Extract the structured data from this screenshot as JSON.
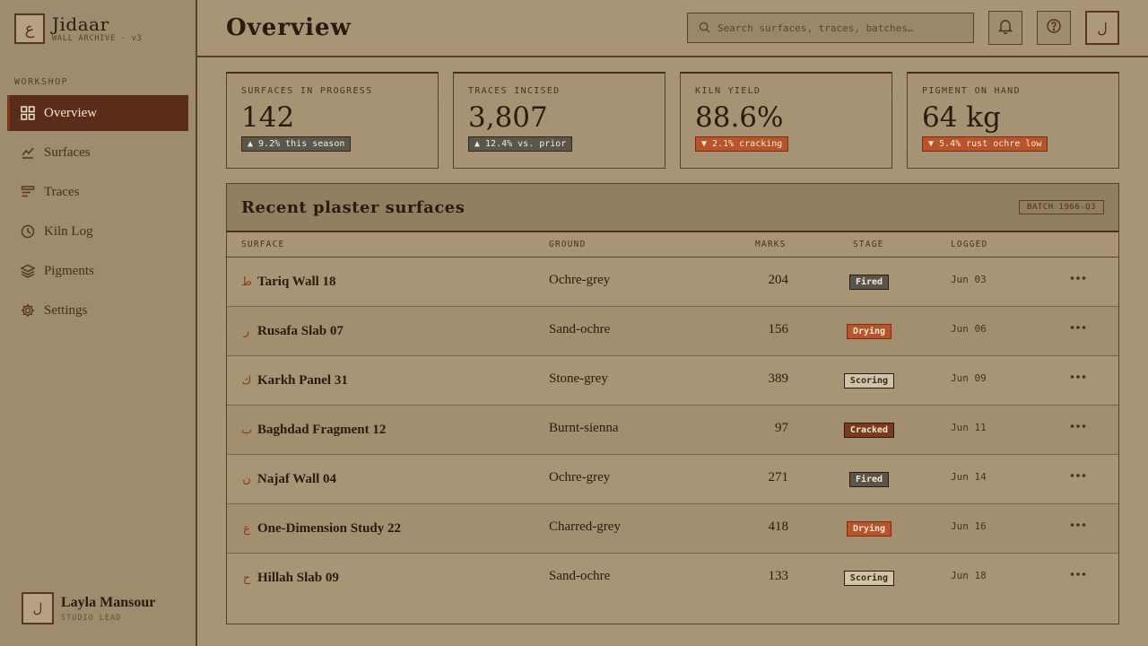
{
  "brand": {
    "name": "Jidaar",
    "subtitle": "WALL ARCHIVE · v3",
    "logo_glyph": "ع"
  },
  "sidebar": {
    "section_label": "WORKSHOP",
    "items": [
      {
        "label": "Overview",
        "icon": "grid-icon",
        "active": true
      },
      {
        "label": "Surfaces",
        "icon": "chart-line-icon",
        "active": false
      },
      {
        "label": "Traces",
        "icon": "layers-list-icon",
        "active": false
      },
      {
        "label": "Kiln Log",
        "icon": "clock-icon",
        "active": false
      },
      {
        "label": "Pigments",
        "icon": "stack-icon",
        "active": false
      },
      {
        "label": "Settings",
        "icon": "gear-icon",
        "active": false
      }
    ],
    "user": {
      "name": "Layla Mansour",
      "role": "STUDIO LEAD",
      "avatar_glyph": "ل"
    }
  },
  "header": {
    "title": "Overview",
    "search_placeholder": "Search surfaces, traces, batches…",
    "avatar_glyph": "ل"
  },
  "stats": [
    {
      "label": "SURFACES IN PROGRESS",
      "value": "142",
      "delta": "▲ 9.2% this season",
      "trend": "up"
    },
    {
      "label": "TRACES INCISED",
      "value": "3,807",
      "delta": "▲ 12.4% vs. prior",
      "trend": "up"
    },
    {
      "label": "KILN YIELD",
      "value": "88.6%",
      "delta": "▼ 2.1% cracking",
      "trend": "down"
    },
    {
      "label": "PIGMENT ON HAND",
      "value": "64 kg",
      "delta": "▼ 5.4% rust ochre low",
      "trend": "down"
    }
  ],
  "table": {
    "title": "Recent plaster surfaces",
    "batch": "BATCH 1966-Q3",
    "columns": [
      "SURFACE",
      "GROUND",
      "MARKS",
      "STAGE",
      "LOGGED"
    ],
    "rows": [
      {
        "glyph": "ط",
        "surface": "Tariq Wall 18",
        "ground": "Ochre-grey",
        "marks": "204",
        "stage": "Fired",
        "stage_kind": "fired",
        "logged": "Jun 03"
      },
      {
        "glyph": "ر",
        "surface": "Rusafa Slab 07",
        "ground": "Sand-ochre",
        "marks": "156",
        "stage": "Drying",
        "stage_kind": "drying",
        "logged": "Jun 06"
      },
      {
        "glyph": "ك",
        "surface": "Karkh Panel 31",
        "ground": "Stone-grey",
        "marks": "389",
        "stage": "Scoring",
        "stage_kind": "scoring",
        "logged": "Jun 09"
      },
      {
        "glyph": "ب",
        "surface": "Baghdad Fragment 12",
        "ground": "Burnt-sienna",
        "marks": "97",
        "stage": "Cracked",
        "stage_kind": "cracked",
        "logged": "Jun 11"
      },
      {
        "glyph": "ن",
        "surface": "Najaf Wall 04",
        "ground": "Ochre-grey",
        "marks": "271",
        "stage": "Fired",
        "stage_kind": "fired",
        "logged": "Jun 14"
      },
      {
        "glyph": "ع",
        "surface": "One-Dimension Study 22",
        "ground": "Charred-grey",
        "marks": "418",
        "stage": "Drying",
        "stage_kind": "drying",
        "logged": "Jun 16"
      },
      {
        "glyph": "ح",
        "surface": "Hillah Slab 09",
        "ground": "Sand-ochre",
        "marks": "133",
        "stage": "Scoring",
        "stage_kind": "scoring",
        "logged": "Jun 18"
      }
    ]
  },
  "colors": {
    "background": "#a89575",
    "sidebar": "#9e8c6e",
    "accent_dark": "#5a2d1a",
    "rust": "#b8532a",
    "ink": "#2c1a10"
  }
}
